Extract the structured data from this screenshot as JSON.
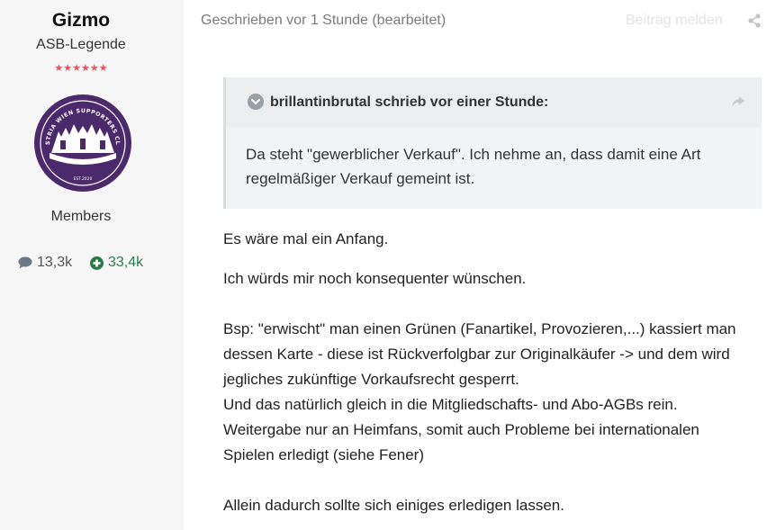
{
  "author": {
    "username": "Gizmo",
    "title": "ASB-Legende",
    "stars": "★★★★★★",
    "avatar_text": "AUSTRIA WIEN SUPPORTERS CLUB",
    "avatar_est": "EST.2020",
    "group": "Members",
    "posts_count": "13,3k",
    "reputation": "33,4k"
  },
  "post": {
    "meta": "Geschrieben vor 1 Stunde (bearbeitet)",
    "report_label": "Beitrag melden",
    "quote": {
      "citation": "brillantinbrutal schrieb vor einer Stunde:",
      "text": "Da steht \"gewerblicher Verkauf\". Ich nehme an, dass damit eine Art regelmäßiger Verkauf gemeint ist."
    },
    "paragraphs": {
      "p1": "Es wäre mal ein Anfang.",
      "p2": "Ich würds mir noch konsequenter wünschen.",
      "p3_lines": [
        "Bsp: \"erwischt\" man einen Grünen (Fanartikel, Provozieren,...) kassiert man",
        "dessen Karte - diese ist Rückverfolgbar zur Originalkäufer -> und dem wird",
        "jegliches zukünftige Vorkaufsrecht gesperrt.",
        "Und das natürlich gleich in die Mitgliedschafts- und Abo-AGBs rein.",
        "Weitergabe nur an Heimfans, somit auch Probleme bei internationalen",
        "Spielen erledigt (siehe Fener)"
      ],
      "p4": "Allein dadurch sollte sich einiges erledigen lassen."
    }
  },
  "colors": {
    "panel_bg": "#f6f6f6",
    "avatar_purple": "#4b2a6b",
    "reputation_green": "#2b7a4b",
    "stars_red": "#e05561"
  },
  "icons": {
    "posts": "comment-icon",
    "reputation": "plus-circle-icon",
    "share": "share-icon",
    "quote_toggle": "chevron-down-circle-icon",
    "quote_goto": "share-arrow-icon"
  }
}
